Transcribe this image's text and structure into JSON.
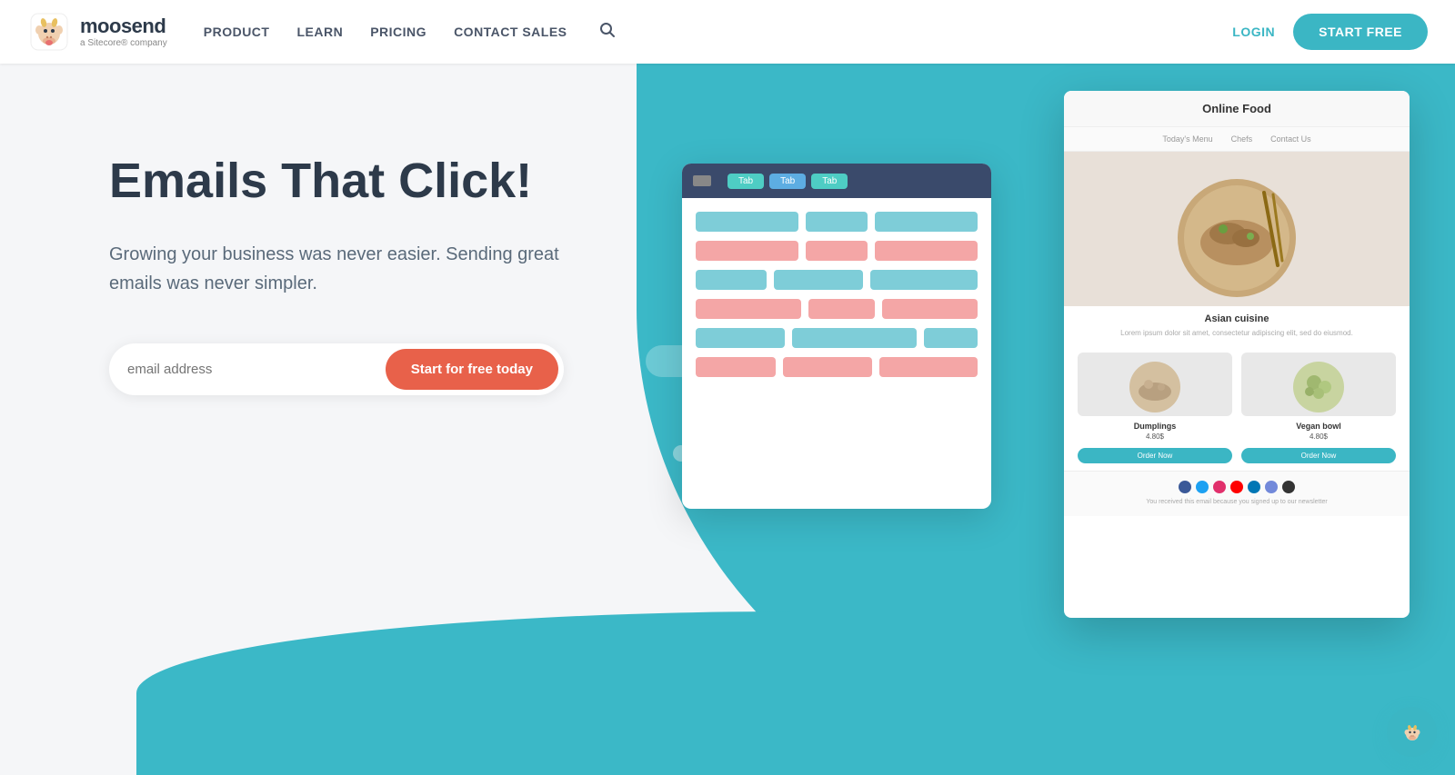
{
  "navbar": {
    "logo_name": "moosend",
    "logo_sub": "a Sitecore® company",
    "nav": {
      "product": "PRODUCT",
      "learn": "LEARN",
      "pricing": "PRICING",
      "contact_sales": "CONTACT SALES"
    },
    "login": "LOGIN",
    "start_free": "START FREE"
  },
  "hero": {
    "title": "Emails That Click!",
    "subtitle": "Growing your business was never easier. Sending great emails was never simpler.",
    "email_placeholder": "email address",
    "cta_button": "Start for free today"
  },
  "email_mockup": {
    "title": "Online Food",
    "nav_items": [
      "Today's Menu",
      "Chefs",
      "Contact Us"
    ],
    "section_title": "Asian cuisine",
    "section_desc": "Lorem ipsum dolor sit amet, consectetur adipiscing elit, sed do eiusmod.",
    "products": [
      {
        "name": "Dumplings",
        "price": "4.80$",
        "btn": "Order Now"
      },
      {
        "name": "Vegan bowl",
        "price": "4.80$",
        "btn": "Order Now"
      }
    ],
    "footer_text": "You received this email because you signed up to our newsletter"
  },
  "chat": {
    "icon": "💬"
  },
  "colors": {
    "teal": "#3bb8c7",
    "cta_orange": "#e8614a",
    "navy": "#2d3a4a"
  }
}
